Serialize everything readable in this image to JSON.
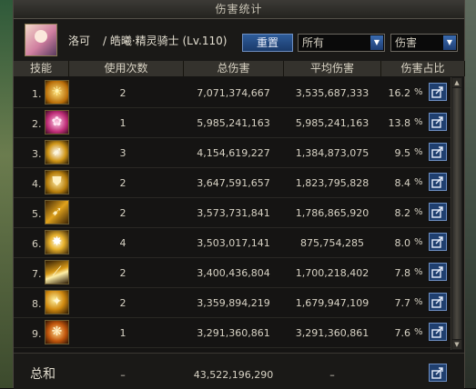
{
  "window": {
    "title": "伤害统计"
  },
  "player": {
    "name": "洛可",
    "class_info": "/ 皓曦·精灵骑士 (Lv.110)"
  },
  "controls": {
    "reset_label": "重置",
    "filter_select": "所有",
    "mode_select": "伤害"
  },
  "columns": {
    "skill": "技能",
    "uses": "使用次数",
    "total": "总伤害",
    "avg": "平均伤害",
    "share": "伤害占比"
  },
  "rows": [
    {
      "index": "1.",
      "icon": "sun-burst-icon",
      "uses": "2",
      "total": "7,071,374,667",
      "avg": "3,535,687,333",
      "share": "16.2",
      "unit": "%"
    },
    {
      "index": "2.",
      "icon": "pink-blossom-icon",
      "uses": "1",
      "total": "5,985,241,163",
      "avg": "5,985,241,163",
      "share": "13.8",
      "unit": "%"
    },
    {
      "index": "3.",
      "icon": "spiral-wind-icon",
      "uses": "3",
      "total": "4,154,619,227",
      "avg": "1,384,873,075",
      "share": "9.5",
      "unit": "%"
    },
    {
      "index": "4.",
      "icon": "shield-icon",
      "uses": "2",
      "total": "3,647,591,657",
      "avg": "1,823,795,828",
      "share": "8.4",
      "unit": "%"
    },
    {
      "index": "5.",
      "icon": "spear-thrust-icon",
      "uses": "2",
      "total": "3,573,731,841",
      "avg": "1,786,865,920",
      "share": "8.2",
      "unit": "%"
    },
    {
      "index": "6.",
      "icon": "star-burst-icon",
      "uses": "4",
      "total": "3,503,017,141",
      "avg": "875,754,285",
      "share": "8.0",
      "unit": "%"
    },
    {
      "index": "7.",
      "icon": "slash-wave-icon",
      "uses": "2",
      "total": "3,400,436,804",
      "avg": "1,700,218,402",
      "share": "7.8",
      "unit": "%"
    },
    {
      "index": "8.",
      "icon": "golden-strike-icon",
      "uses": "2",
      "total": "3,359,894,219",
      "avg": "1,679,947,109",
      "share": "7.7",
      "unit": "%"
    },
    {
      "index": "9.",
      "icon": "phoenix-icon",
      "uses": "1",
      "total": "3,291,360,861",
      "avg": "3,291,360,861",
      "share": "7.6",
      "unit": "%"
    }
  ],
  "footer": {
    "label": "总和",
    "uses": "–",
    "total": "43,522,196,290",
    "avg": "–"
  },
  "colors": {
    "accent": "#1f3f6f",
    "icon_gold": "#e0a21c",
    "panel": "#151413"
  }
}
